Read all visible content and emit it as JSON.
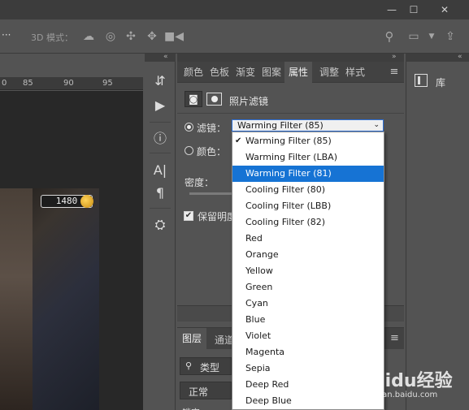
{
  "optionsbar": {
    "mode_label": "3D 模式："
  },
  "ruler": {
    "ticks": [
      "0",
      "85",
      "90",
      "95"
    ]
  },
  "canvas": {
    "score": "1480"
  },
  "properties": {
    "tabs": [
      "颜色",
      "色板",
      "渐变",
      "图案",
      "属性",
      "调整",
      "样式"
    ],
    "active_tab": "属性",
    "title": "照片滤镜",
    "filter_label": "滤镜：",
    "color_label": "颜色：",
    "density_label": "密度：",
    "preserve_label": "保留明度",
    "selected_filter": "Warming Filter (85)"
  },
  "library": {
    "label": "库"
  },
  "layers": {
    "tab_label": "图层",
    "tab2_label": "通道",
    "search_label": "类型",
    "blend_mode": "正常",
    "lock_label": "锁定"
  },
  "dropdown": {
    "options": [
      "Warming Filter (85)",
      "Warming Filter (LBA)",
      "Warming Filter (81)",
      "Cooling Filter (80)",
      "Cooling Filter (LBB)",
      "Cooling Filter (82)",
      "Red",
      "Orange",
      "Yellow",
      "Green",
      "Cyan",
      "Blue",
      "Violet",
      "Magenta",
      "Sepia",
      "Deep Red",
      "Deep Blue"
    ],
    "checked_index": 0,
    "highlighted_index": 2
  },
  "watermark": {
    "brand": "Baidu经验",
    "url": "jingyan.baidu.com"
  },
  "colors": {
    "accent": "#1673d4",
    "panel": "#535353",
    "dark": "#3c3c3c"
  }
}
